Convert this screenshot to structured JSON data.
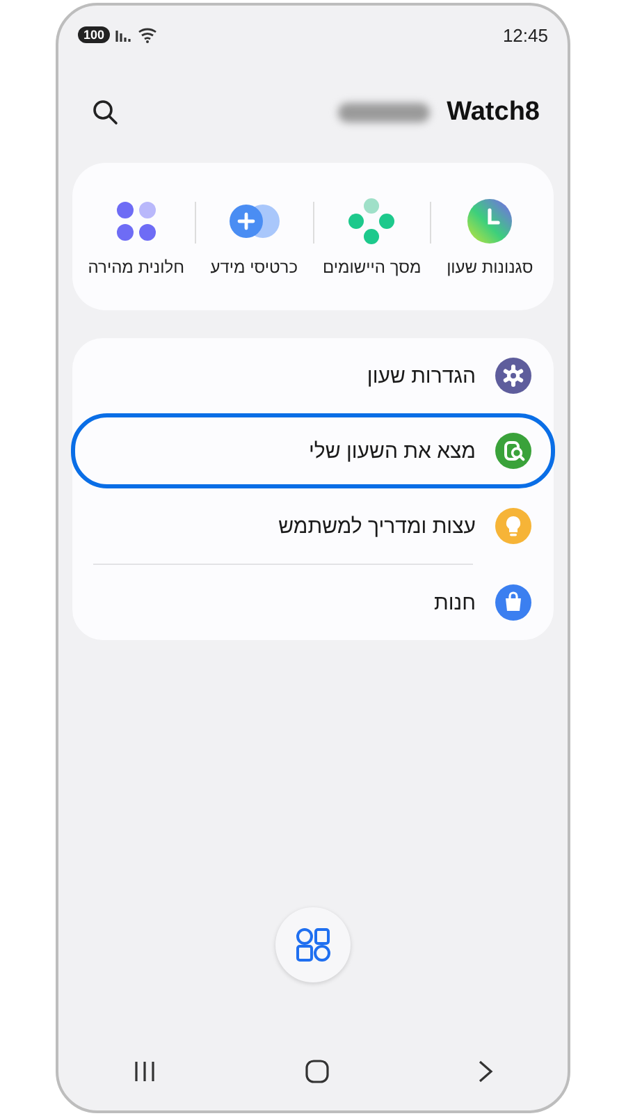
{
  "status_bar": {
    "battery": "100",
    "time": "12:45"
  },
  "header": {
    "title": "Watch8"
  },
  "shortcuts": [
    {
      "label": "סגנונות שעון",
      "kind": "faces"
    },
    {
      "label": "מסך היישומים",
      "kind": "apps"
    },
    {
      "label": "כרטיסי מידע",
      "kind": "tiles"
    },
    {
      "label": "חלונית מהירה",
      "kind": "quick"
    }
  ],
  "menu": [
    {
      "label": "הגדרות שעון",
      "kind": "settings",
      "highlighted": false
    },
    {
      "label": "מצא את השעון שלי",
      "kind": "find",
      "highlighted": true
    },
    {
      "label": "עצות ומדריך למשתמש",
      "kind": "tips",
      "highlighted": false
    },
    {
      "label": "חנות",
      "kind": "store",
      "highlighted": false
    }
  ]
}
